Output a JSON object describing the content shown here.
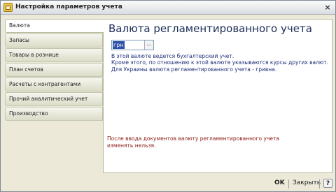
{
  "window": {
    "title": "Настройка параметров учета",
    "close_glyph": "×"
  },
  "sidebar": {
    "tabs": [
      {
        "label": "Валюта",
        "active": true
      },
      {
        "label": "Запасы",
        "active": false
      },
      {
        "label": "Товары в рознице",
        "active": false
      },
      {
        "label": "План счетов",
        "active": false
      },
      {
        "label": "Расчеты с контрагентами",
        "active": false
      },
      {
        "label": "Прочий аналитический учет",
        "active": false
      },
      {
        "label": "Производство",
        "active": false
      }
    ]
  },
  "main": {
    "heading": "Валюта регламентированного учета",
    "currency_field": {
      "value": "грн",
      "select_glyph": "..."
    },
    "info_lines": [
      "В этой валюте ведется бухгалтерский учет.",
      "Кроме этого, по отношению к этой валюте указываются курсы других валют.",
      "Для Украины валюта регламентированного учета - гривна."
    ],
    "warning_lines": [
      "После ввода документов валюту регламентированного учета",
      " изменять нельзя."
    ]
  },
  "footer": {
    "ok_label": "OK",
    "close_label": "Закрыть",
    "help_label": "?"
  },
  "colors": {
    "heading": "#1c2d57",
    "info_text": "#1f2f77",
    "warning_text": "#8a1b14",
    "selection": "#2b4fa6"
  },
  "icons": {
    "title": "app-settings-icon",
    "help": "help-icon"
  }
}
